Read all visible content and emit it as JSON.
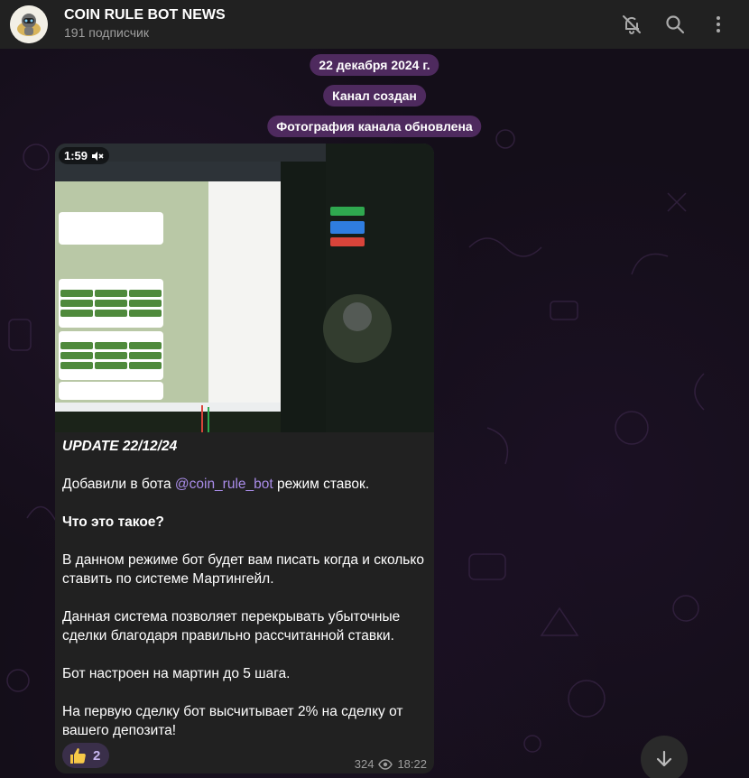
{
  "header": {
    "title": "COIN RULE BOT NEWS",
    "subtitle": "191 подписчик",
    "icons": [
      "bell-off-icon",
      "search-icon",
      "more-vertical-icon"
    ]
  },
  "service": {
    "date": "22 декабря 2024 г.",
    "created": "Канал создан",
    "photo_updated": "Фотография канала обновлена"
  },
  "message": {
    "duration": "1:59",
    "title": "UPDATE 22/12/24",
    "p1_before": "Добавили в бота ",
    "p1_mention": "@coin_rule_bot",
    "p1_after": " режим ставок.",
    "q": "Что это такое?",
    "p2": "В данном режиме бот будет вам писать когда и сколько ставить по системе Мартингейл.",
    "p3": "Данная система позволяет перекрывать убыточные сделки благодаря правильно рассчитанной ставки.",
    "p4": "Бот настроен на мартин до 5 шага.",
    "p5": "На первую сделку бот высчитывает 2% на сделку от вашего депозита!",
    "reaction_count": "2",
    "views": "324",
    "time": "18:22"
  },
  "colors": {
    "header_bg": "#212121",
    "pill_bg": "#542c64",
    "bubble_bg": "#212121",
    "mention": "#a98ce8"
  }
}
